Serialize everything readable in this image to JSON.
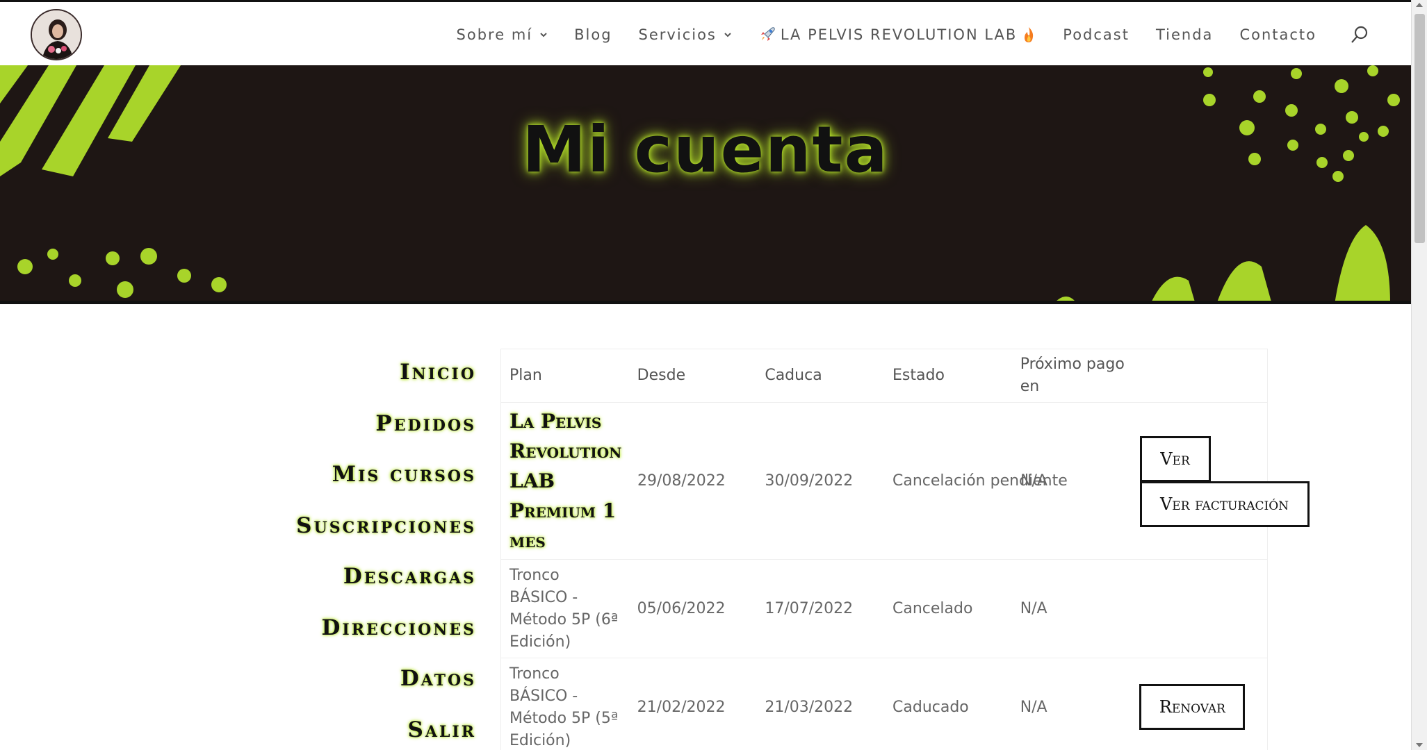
{
  "header": {
    "nav": [
      {
        "label": "Sobre mí",
        "dropdown": true
      },
      {
        "label": "Blog",
        "dropdown": false
      },
      {
        "label": "Servicios",
        "dropdown": true
      },
      {
        "label": "LA PELVIS REVOLUTION LAB",
        "icon_before": "rocket-icon",
        "icon_after": "fire-icon"
      },
      {
        "label": "Podcast",
        "dropdown": false
      },
      {
        "label": "Tienda",
        "dropdown": false
      },
      {
        "label": "Contacto",
        "dropdown": false
      }
    ]
  },
  "hero": {
    "title": "Mi cuenta",
    "accent_color": "#a8d42a",
    "background_color": "#1e1614"
  },
  "account_nav": [
    "Inicio",
    "Pedidos",
    "Mis cursos",
    "Suscripciones",
    "Descargas",
    "Direcciones",
    "Datos",
    "Salir"
  ],
  "table": {
    "headers": [
      "Plan",
      "Desde",
      "Caduca",
      "Estado",
      "Próximo pago en",
      ""
    ],
    "rows": [
      {
        "plan": "La Pelvis Revolution LAB Premium 1 mes",
        "desde": "29/08/2022",
        "caduca": "30/09/2022",
        "estado": "Cancelación pendiente",
        "proximo": "N/A",
        "actions": [
          "Ver",
          "Ver facturación"
        ]
      },
      {
        "plan": "Tronco BÁSICO - Método 5P (6ª Edición)",
        "desde": "05/06/2022",
        "caduca": "17/07/2022",
        "estado": "Cancelado",
        "proximo": "N/A",
        "actions": []
      },
      {
        "plan": "Tronco BÁSICO - Método 5P (5ª Edición)",
        "desde": "21/02/2022",
        "caduca": "21/03/2022",
        "estado": "Caducado",
        "proximo": "N/A",
        "actions": [
          "Renovar"
        ]
      }
    ]
  }
}
